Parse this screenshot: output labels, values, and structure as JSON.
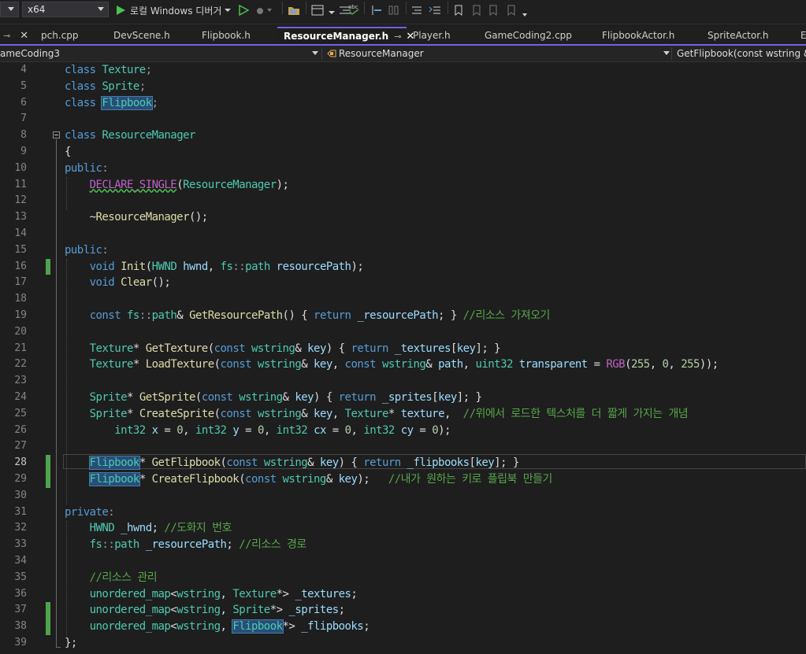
{
  "toolbar": {
    "config_left": "",
    "platform": "x64",
    "debugger_label": "로컬 Windows 디버거",
    "colors": {
      "play": "#4cc24c",
      "bookmark": "#d0d0d0"
    }
  },
  "tabs": [
    {
      "label": "pch.cpp",
      "active": false
    },
    {
      "label": "DevScene.h",
      "active": false
    },
    {
      "label": "Flipbook.h",
      "active": false
    },
    {
      "label": "ResourceManager.h",
      "active": true
    },
    {
      "label": "Player.h",
      "active": false
    },
    {
      "label": "GameCoding2.cpp",
      "active": false
    },
    {
      "label": "FlipbookActor.h",
      "active": false
    },
    {
      "label": "SpriteActor.h",
      "active": false
    },
    {
      "label": "Er",
      "active": false
    }
  ],
  "navbar": {
    "project": "ameCoding3",
    "scope": "ResourceManager",
    "member": "GetFlipbook(const wstring &"
  },
  "editor": {
    "current_line": 28,
    "line_numbers": [
      "4",
      "5",
      "6",
      "7",
      "8",
      "9",
      "10",
      "11",
      "12",
      "13",
      "14",
      "15",
      "16",
      "17",
      "18",
      "19",
      "20",
      "21",
      "22",
      "23",
      "24",
      "25",
      "26",
      "27",
      "28",
      "29",
      "30",
      "31",
      "32",
      "33",
      "34",
      "35",
      "36",
      "37",
      "38",
      "39"
    ],
    "lines": [
      [
        [
          "kw",
          "class "
        ],
        [
          "ty",
          "Texture"
        ],
        [
          "pm",
          ";"
        ]
      ],
      [
        [
          "kw",
          "class "
        ],
        [
          "ty",
          "Sprite"
        ],
        [
          "pm",
          ";"
        ]
      ],
      [
        [
          "kw",
          "class "
        ],
        [
          "tyhl",
          "Flipbook"
        ],
        [
          "pm",
          ";"
        ]
      ],
      [],
      [
        [
          "kw",
          "class "
        ],
        [
          "ty",
          "ResourceManager"
        ]
      ],
      [
        [
          "pl",
          "{"
        ]
      ],
      [
        [
          "kw",
          "public"
        ],
        [
          "pm",
          ":"
        ]
      ],
      [
        [
          "pl",
          "    "
        ],
        [
          "mcsq",
          "DECLARE_SINGLE"
        ],
        [
          "pl",
          "("
        ],
        [
          "ty",
          "ResourceManager"
        ],
        [
          "pl",
          ");"
        ]
      ],
      [],
      [
        [
          "pl",
          "    ~"
        ],
        [
          "fn",
          "ResourceManager"
        ],
        [
          "pl",
          "();"
        ]
      ],
      [],
      [
        [
          "kw",
          "public"
        ],
        [
          "pm",
          ":"
        ]
      ],
      [
        [
          "pl",
          "    "
        ],
        [
          "kw",
          "void "
        ],
        [
          "fn",
          "Init"
        ],
        [
          "pl",
          "("
        ],
        [
          "ty",
          "HWND "
        ],
        [
          "id",
          "hwnd"
        ],
        [
          "pl",
          ", "
        ],
        [
          "ty",
          "fs"
        ],
        [
          "pm",
          "::"
        ],
        [
          "ty",
          "path "
        ],
        [
          "id",
          "resourcePath"
        ],
        [
          "pl",
          ");"
        ]
      ],
      [
        [
          "pl",
          "    "
        ],
        [
          "kw",
          "void "
        ],
        [
          "fn",
          "Clear"
        ],
        [
          "pl",
          "();"
        ]
      ],
      [],
      [
        [
          "pl",
          "    "
        ],
        [
          "kw",
          "const "
        ],
        [
          "ty",
          "fs"
        ],
        [
          "pm",
          "::"
        ],
        [
          "ty",
          "path"
        ],
        [
          "pl",
          "& "
        ],
        [
          "fn",
          "GetResourcePath"
        ],
        [
          "pl",
          "() { "
        ],
        [
          "kw",
          "return "
        ],
        [
          "id",
          "_resourcePath"
        ],
        [
          "pl",
          "; } "
        ],
        [
          "cm",
          "//리소스 가져오기"
        ]
      ],
      [],
      [
        [
          "pl",
          "    "
        ],
        [
          "ty",
          "Texture"
        ],
        [
          "pl",
          "* "
        ],
        [
          "fn",
          "GetTexture"
        ],
        [
          "pl",
          "("
        ],
        [
          "kw",
          "const "
        ],
        [
          "ty",
          "wstring"
        ],
        [
          "pl",
          "& "
        ],
        [
          "id",
          "key"
        ],
        [
          "pl",
          ") { "
        ],
        [
          "kw",
          "return "
        ],
        [
          "id",
          "_textures"
        ],
        [
          "pl",
          "["
        ],
        [
          "id",
          "key"
        ],
        [
          "pl",
          "]; }"
        ]
      ],
      [
        [
          "pl",
          "    "
        ],
        [
          "ty",
          "Texture"
        ],
        [
          "pl",
          "* "
        ],
        [
          "fn",
          "LoadTexture"
        ],
        [
          "pl",
          "("
        ],
        [
          "kw",
          "const "
        ],
        [
          "ty",
          "wstring"
        ],
        [
          "pl",
          "& "
        ],
        [
          "id",
          "key"
        ],
        [
          "pl",
          ", "
        ],
        [
          "kw",
          "const "
        ],
        [
          "ty",
          "wstring"
        ],
        [
          "pl",
          "& "
        ],
        [
          "id",
          "path"
        ],
        [
          "pl",
          ", "
        ],
        [
          "ty",
          "uint32 "
        ],
        [
          "id",
          "transparent"
        ],
        [
          "pl",
          " = "
        ],
        [
          "mc",
          "RGB"
        ],
        [
          "pl",
          "("
        ],
        [
          "nm",
          "255"
        ],
        [
          "pl",
          ", "
        ],
        [
          "nm",
          "0"
        ],
        [
          "pl",
          ", "
        ],
        [
          "nm",
          "255"
        ],
        [
          "pl",
          "));"
        ]
      ],
      [],
      [
        [
          "pl",
          "    "
        ],
        [
          "ty",
          "Sprite"
        ],
        [
          "pl",
          "* "
        ],
        [
          "fn",
          "GetSprite"
        ],
        [
          "pl",
          "("
        ],
        [
          "kw",
          "const "
        ],
        [
          "ty",
          "wstring"
        ],
        [
          "pl",
          "& "
        ],
        [
          "id",
          "key"
        ],
        [
          "pl",
          ") { "
        ],
        [
          "kw",
          "return "
        ],
        [
          "id",
          "_sprites"
        ],
        [
          "pl",
          "["
        ],
        [
          "id",
          "key"
        ],
        [
          "pl",
          "]; }"
        ]
      ],
      [
        [
          "pl",
          "    "
        ],
        [
          "ty",
          "Sprite"
        ],
        [
          "pl",
          "* "
        ],
        [
          "fn",
          "CreateSprite"
        ],
        [
          "pl",
          "("
        ],
        [
          "kw",
          "const "
        ],
        [
          "ty",
          "wstring"
        ],
        [
          "pl",
          "& "
        ],
        [
          "id",
          "key"
        ],
        [
          "pl",
          ", "
        ],
        [
          "ty",
          "Texture"
        ],
        [
          "pl",
          "* "
        ],
        [
          "id",
          "texture"
        ],
        [
          "pl",
          ",  "
        ],
        [
          "cm",
          "//위에서 로드한 텍스처를 더 짧게 가지는 개념"
        ]
      ],
      [
        [
          "pl",
          "        "
        ],
        [
          "ty",
          "int32 "
        ],
        [
          "id",
          "x"
        ],
        [
          "pl",
          " = "
        ],
        [
          "nm",
          "0"
        ],
        [
          "pl",
          ", "
        ],
        [
          "ty",
          "int32 "
        ],
        [
          "id",
          "y"
        ],
        [
          "pl",
          " = "
        ],
        [
          "nm",
          "0"
        ],
        [
          "pl",
          ", "
        ],
        [
          "ty",
          "int32 "
        ],
        [
          "id",
          "cx"
        ],
        [
          "pl",
          " = "
        ],
        [
          "nm",
          "0"
        ],
        [
          "pl",
          ", "
        ],
        [
          "ty",
          "int32 "
        ],
        [
          "id",
          "cy"
        ],
        [
          "pl",
          " = "
        ],
        [
          "nm",
          "0"
        ],
        [
          "pl",
          ");"
        ]
      ],
      [],
      [
        [
          "pl",
          "    "
        ],
        [
          "tyhl",
          "Flipbook"
        ],
        [
          "pl",
          "* "
        ],
        [
          "fn",
          "GetFlipbook"
        ],
        [
          "pl",
          "("
        ],
        [
          "kw",
          "const "
        ],
        [
          "ty",
          "wstring"
        ],
        [
          "pl",
          "& "
        ],
        [
          "id",
          "key"
        ],
        [
          "pl",
          ") { "
        ],
        [
          "kw",
          "return "
        ],
        [
          "id",
          "_flipbooks"
        ],
        [
          "pl",
          "["
        ],
        [
          "id",
          "key"
        ],
        [
          "pl",
          "]; }"
        ]
      ],
      [
        [
          "pl",
          "    "
        ],
        [
          "tyhl",
          "Flipbook"
        ],
        [
          "pl",
          "* "
        ],
        [
          "fn",
          "CreateFlipbook"
        ],
        [
          "pl",
          "("
        ],
        [
          "kw",
          "const "
        ],
        [
          "ty",
          "wstring"
        ],
        [
          "pl",
          "& "
        ],
        [
          "id",
          "key"
        ],
        [
          "pl",
          ");   "
        ],
        [
          "cm",
          "//내가 원하는 키로 플립북 만들기"
        ]
      ],
      [],
      [
        [
          "kw",
          "private"
        ],
        [
          "pm",
          ":"
        ]
      ],
      [
        [
          "pl",
          "    "
        ],
        [
          "ty",
          "HWND "
        ],
        [
          "id",
          "_hwnd"
        ],
        [
          "pl",
          "; "
        ],
        [
          "cm",
          "//도화지 번호"
        ]
      ],
      [
        [
          "pl",
          "    "
        ],
        [
          "ty",
          "fs"
        ],
        [
          "pm",
          "::"
        ],
        [
          "ty",
          "path "
        ],
        [
          "id",
          "_resourcePath"
        ],
        [
          "pl",
          "; "
        ],
        [
          "cm",
          "//리소스 경로"
        ]
      ],
      [],
      [
        [
          "pl",
          "    "
        ],
        [
          "cm",
          "//리소스 관리"
        ]
      ],
      [
        [
          "pl",
          "    "
        ],
        [
          "ty",
          "unordered_map"
        ],
        [
          "pl",
          "<"
        ],
        [
          "ty",
          "wstring"
        ],
        [
          "pl",
          ", "
        ],
        [
          "ty",
          "Texture"
        ],
        [
          "pl",
          "*> "
        ],
        [
          "id",
          "_textures"
        ],
        [
          "pl",
          ";"
        ]
      ],
      [
        [
          "pl",
          "    "
        ],
        [
          "ty",
          "unordered_map"
        ],
        [
          "pl",
          "<"
        ],
        [
          "ty",
          "wstring"
        ],
        [
          "pl",
          ", "
        ],
        [
          "ty",
          "Sprite"
        ],
        [
          "pl",
          "*> "
        ],
        [
          "id",
          "_sprites"
        ],
        [
          "pl",
          ";"
        ]
      ],
      [
        [
          "pl",
          "    "
        ],
        [
          "ty",
          "unordered_map"
        ],
        [
          "pl",
          "<"
        ],
        [
          "ty",
          "wstring"
        ],
        [
          "pl",
          ", "
        ],
        [
          "tyhl",
          "Flipbook"
        ],
        [
          "pl",
          "*> "
        ],
        [
          "id",
          "_flipbooks"
        ],
        [
          "pl",
          ";"
        ]
      ],
      [
        [
          "pl",
          "};"
        ]
      ]
    ],
    "change_lines": [
      16,
      28,
      29,
      37,
      38
    ]
  }
}
